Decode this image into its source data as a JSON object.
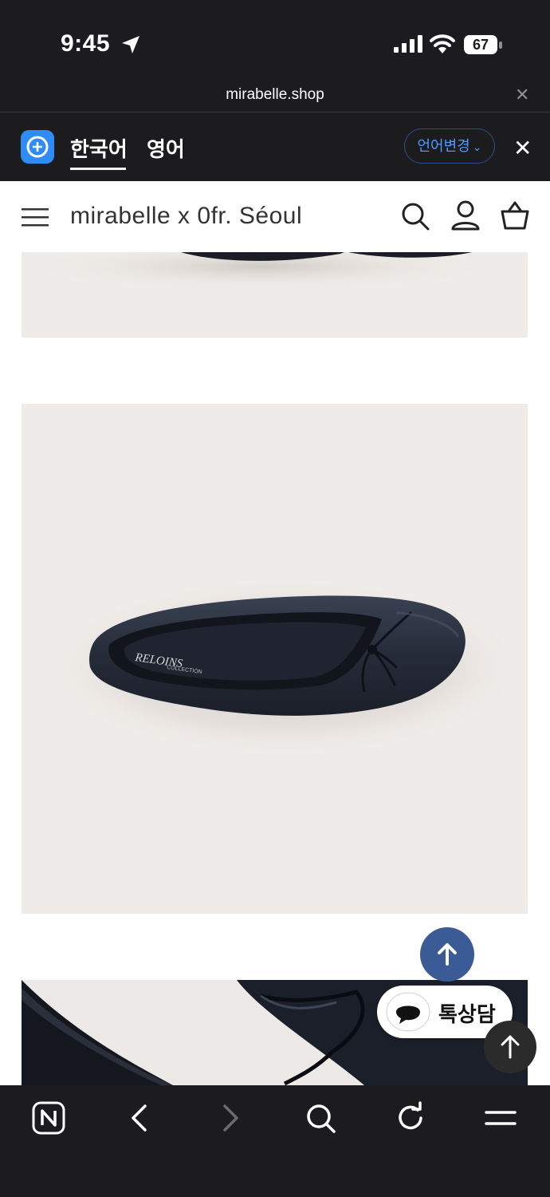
{
  "status_bar": {
    "time": "9:45",
    "battery": "67",
    "icons": [
      "location-arrow-icon",
      "cellular-signal-icon",
      "wifi-icon",
      "battery-icon"
    ]
  },
  "url_bar": {
    "url": "mirabelle.shop",
    "close_icon": "close-icon"
  },
  "translate_bar": {
    "tabs": [
      "한국어",
      "영어"
    ],
    "active_tab": 0,
    "change_language_label": "언어변경",
    "close_icon": "close-icon"
  },
  "header": {
    "site_title": "mirabelle x 0fr. Séoul",
    "icons": [
      "menu-icon",
      "search-icon",
      "user-icon",
      "shopping-basket-icon"
    ]
  },
  "product_images": {
    "insole_brand": "RELOINS",
    "insole_sub": "COLLECTION"
  },
  "floating": {
    "chat_label": "톡상담",
    "icons": [
      "arrow-up-icon",
      "chat-bubble-icon",
      "arrow-up-icon"
    ]
  },
  "toolbar": {
    "icons": [
      "naver-n-icon",
      "back-icon",
      "forward-icon",
      "search-icon",
      "refresh-icon",
      "menu-icon"
    ]
  },
  "colors": {
    "system_dark": "#1c1c1e",
    "accent_blue": "#2f8cf5",
    "scroll_top_blue": "#3a5b95",
    "image_bg": "#efebe8"
  }
}
